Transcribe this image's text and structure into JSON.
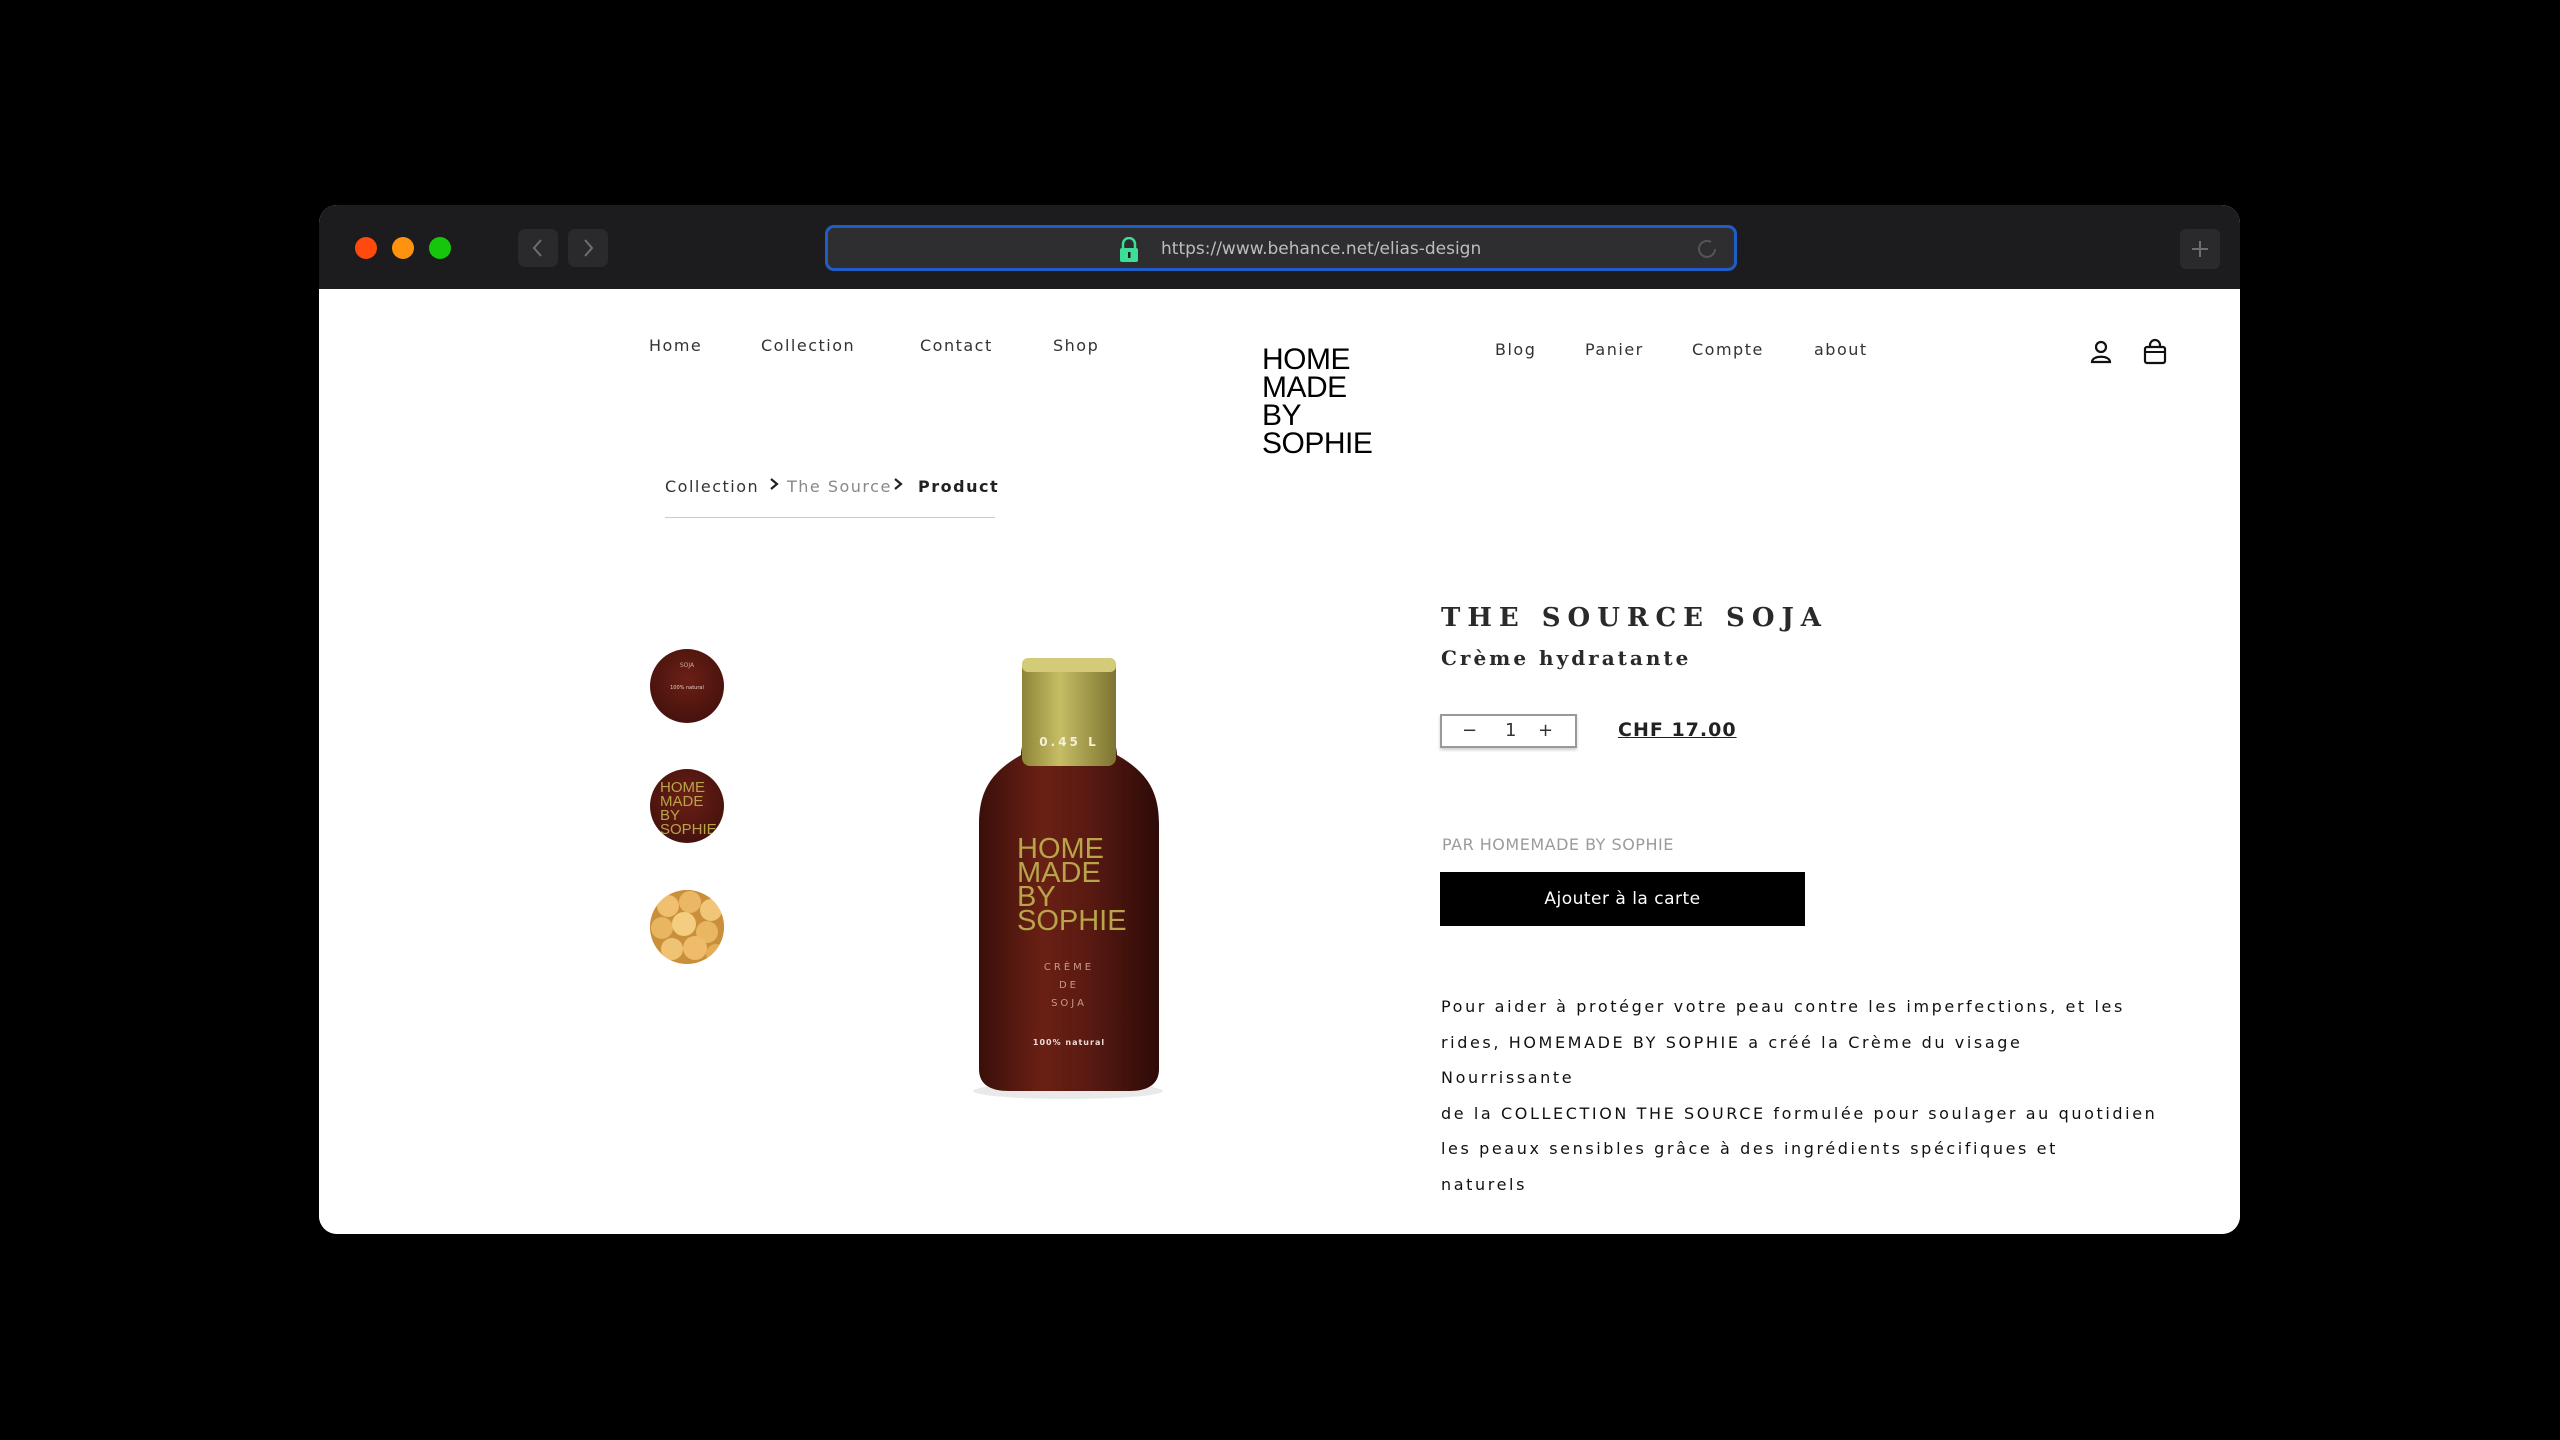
{
  "browser": {
    "url": "https://www.behance.net/elias-design",
    "back_icon": "chevron-left-icon",
    "forward_icon": "chevron-right-icon",
    "new_tab_icon": "plus-icon",
    "traffic_colors": [
      "#fe4a0f",
      "#ff930f",
      "#16c60c"
    ]
  },
  "nav": {
    "left": [
      "Home",
      "Collection",
      "Contact",
      "Shop"
    ],
    "right": [
      "Blog",
      "Panier",
      "Compte",
      "about"
    ],
    "logo_lines": [
      "HOME",
      "MADE",
      "BY",
      "SOPHIE"
    ]
  },
  "breadcrumb": {
    "collection": "Collection",
    "source": "The Source",
    "product": "Product"
  },
  "product_image": {
    "volume_label": "0.45 L",
    "brand_lines": [
      "HOME",
      "MADE",
      "BY",
      "SOPHIE"
    ],
    "variant_lines": [
      "CRÈME",
      "DE",
      "SOJA"
    ],
    "natural_label": "100% natural"
  },
  "thumbnails": {
    "thumb1_text": "SOJA",
    "thumb1_sub": "100% natural",
    "thumb2_lines": [
      "HOME",
      "MADE",
      "BY",
      "SOPHIE"
    ]
  },
  "product": {
    "title": "THE SOURCE SOJA",
    "subtitle": "Crème hydratante",
    "quantity": "1",
    "minus": "−",
    "plus": "+",
    "price": "CHF 17.00",
    "vendor": "PAR HOMEMADE BY SOPHIE",
    "add_to_cart": "Ajouter à la carte",
    "description_lines": [
      "Pour aider à protéger votre peau contre les imperfections, et les",
      "rides, HOMEMADE BY SOPHIE a créé la Crème du visage Nourrissante",
      "de la COLLECTION THE SOURCE formulée pour soulager au quotidien",
      "les peaux sensibles grâce à des ingrédients spécifiques et",
      "naturels"
    ]
  },
  "colors": {
    "bottle": "#5a1a12",
    "cap": "#b5ab52",
    "bottle_text": "#b8a44a",
    "focus_ring": "#1f5ec7",
    "lock": "#3ddc97"
  }
}
